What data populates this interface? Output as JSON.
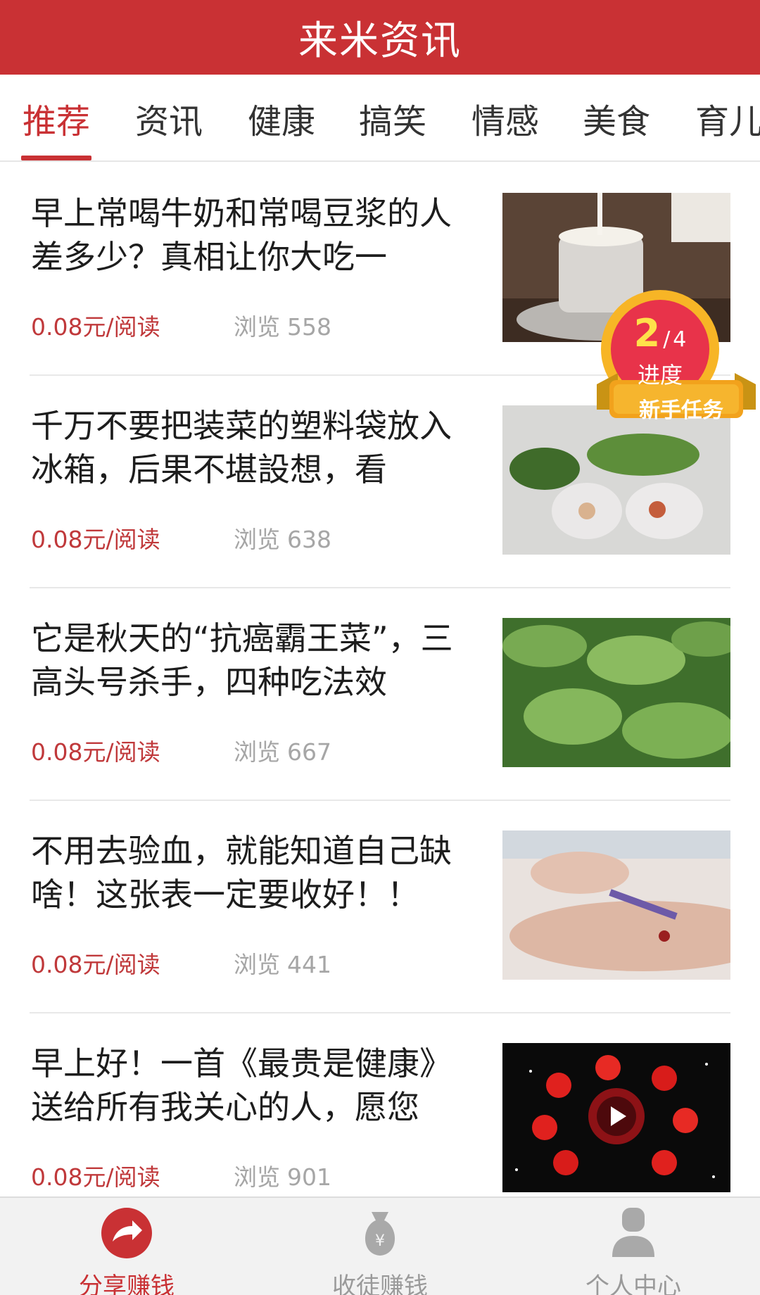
{
  "header": {
    "title": "来米资讯"
  },
  "tabs": [
    {
      "label": "推荐",
      "active": true
    },
    {
      "label": "资讯",
      "active": false
    },
    {
      "label": "健康",
      "active": false
    },
    {
      "label": "搞笑",
      "active": false
    },
    {
      "label": "情感",
      "active": false
    },
    {
      "label": "美食",
      "active": false
    },
    {
      "label": "育儿",
      "active": false
    }
  ],
  "feed": {
    "items": [
      {
        "title": "早上常喝牛奶和常喝豆浆的人差多少？真相让你大吃一",
        "price": "0.08元/阅读",
        "views_label": "浏览",
        "views": "558",
        "thumb": "milk-cup-image"
      },
      {
        "title": "千万不要把装菜的塑料袋放入冰箱，后果不堪設想，看",
        "price": "0.08元/阅读",
        "views_label": "浏览",
        "views": "638",
        "thumb": "vegetables-in-bags-image"
      },
      {
        "title": "它是秋天的“抗癌霸王菜”，三高头号杀手，四种吃法效",
        "price": "0.08元/阅读",
        "views_label": "浏览",
        "views": "667",
        "thumb": "leafy-greens-image"
      },
      {
        "title": "不用去验血，就能知道自己缺啥！这张表一定要收好！！",
        "price": "0.08元/阅读",
        "views_label": "浏览",
        "views": "441",
        "thumb": "blood-test-image"
      },
      {
        "title": "早上好！一首《最贵是健康》送给所有我关心的人，愿您",
        "price": "0.08元/阅读",
        "views_label": "浏览",
        "views": "901",
        "thumb": "roses-video-image"
      }
    ]
  },
  "badge": {
    "current": "2",
    "separator": "/",
    "total": "4",
    "progress_label": "进度",
    "ribbon_label": "新手任务"
  },
  "bottom_nav": [
    {
      "label": "分享赚钱",
      "icon": "share-arrow-icon",
      "active": true
    },
    {
      "label": "收徒赚钱",
      "icon": "money-bag-icon",
      "active": false
    },
    {
      "label": "个人中心",
      "icon": "user-icon",
      "active": false
    }
  ],
  "colors": {
    "brand_red": "#c93134",
    "price_red": "#c0393b",
    "muted_gray": "#a6a6a6",
    "nav_gray": "#9a9a9a"
  }
}
